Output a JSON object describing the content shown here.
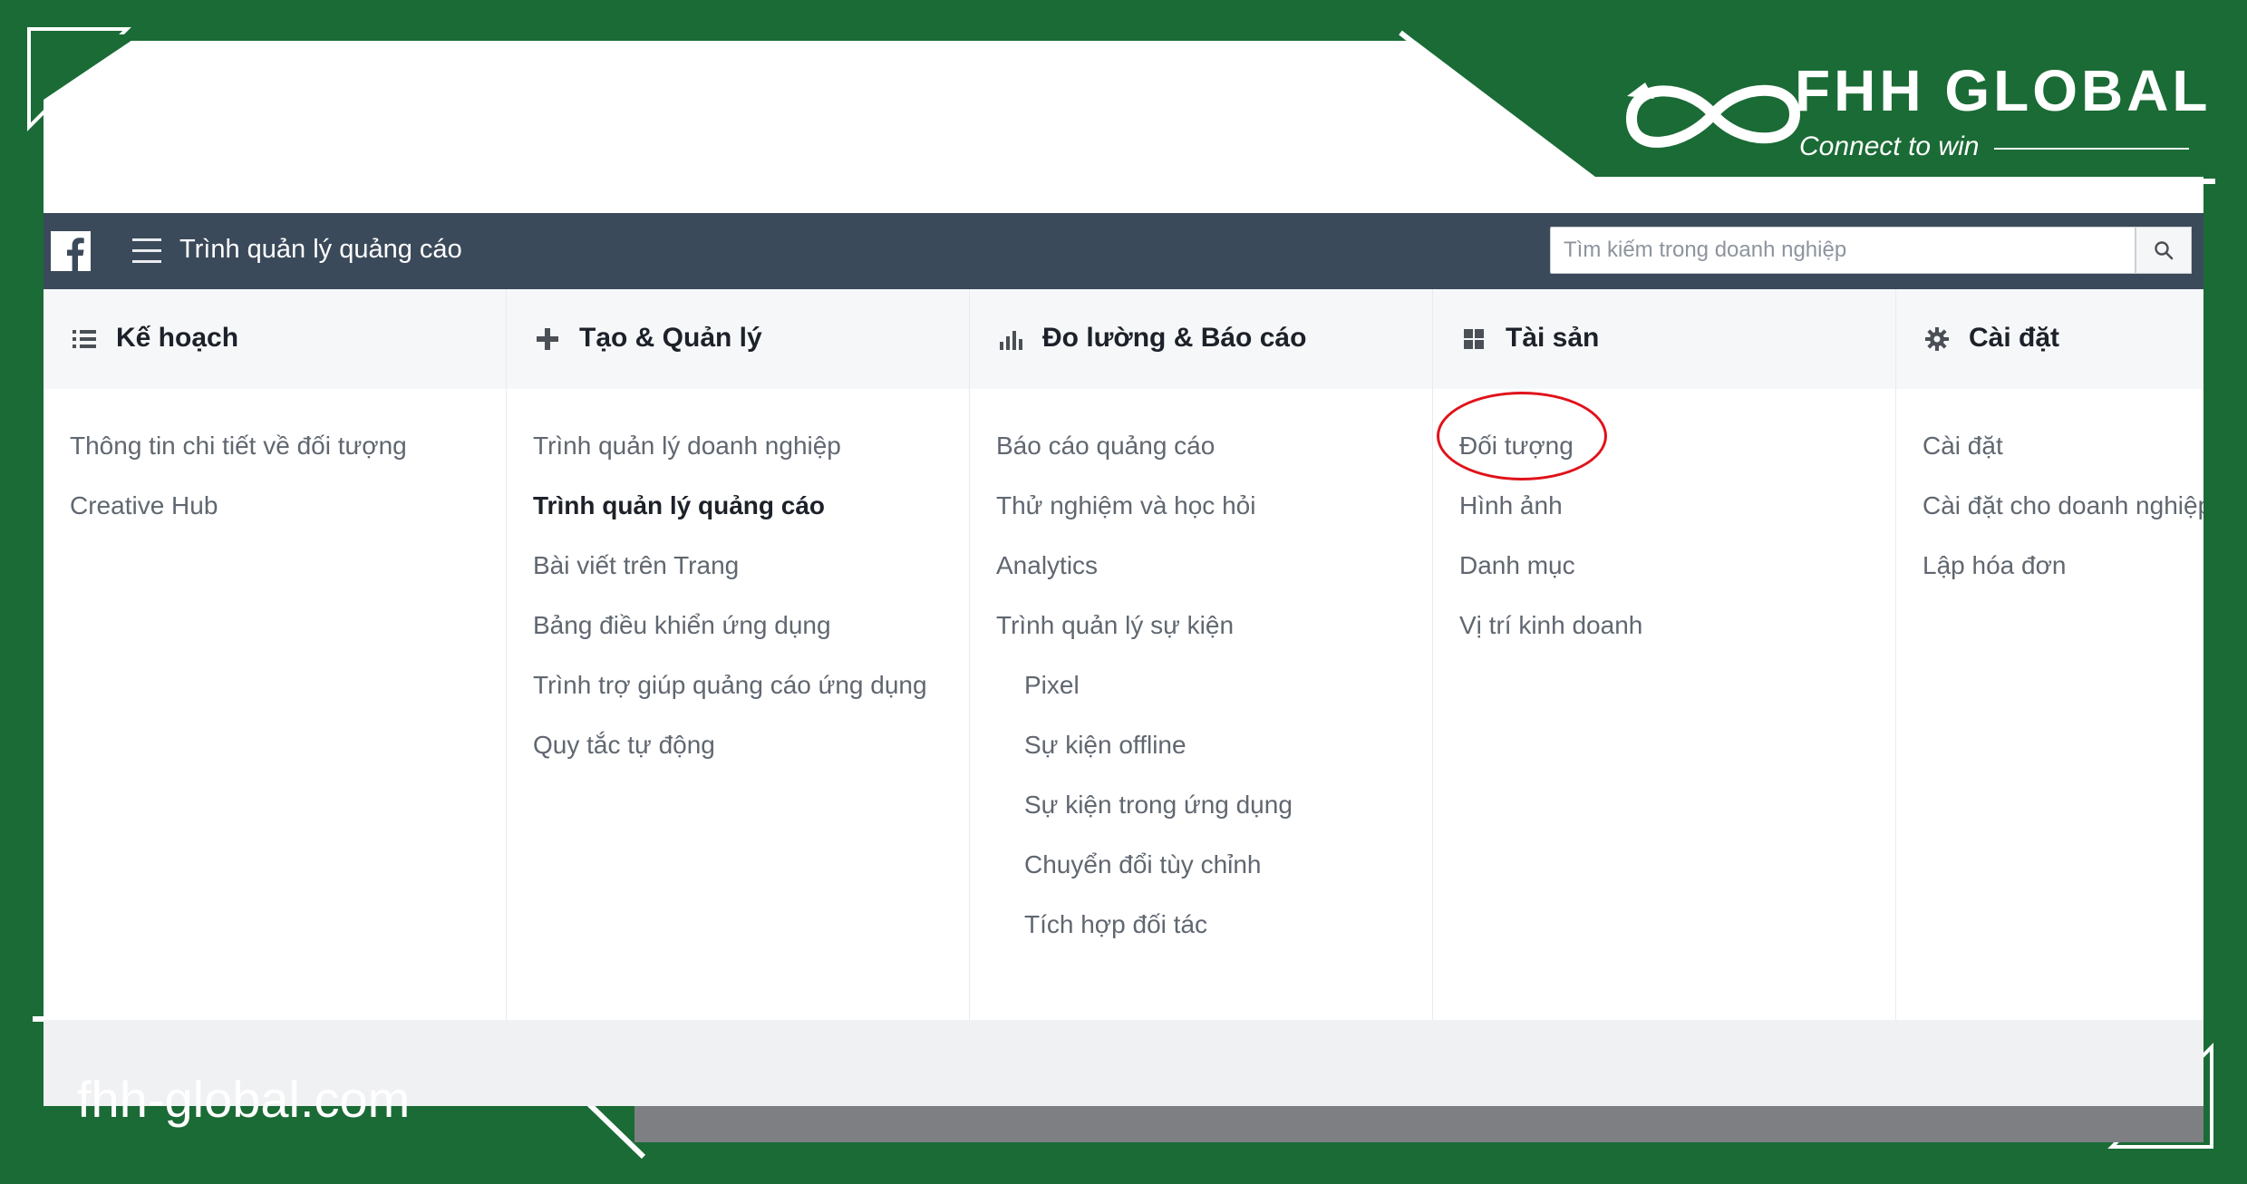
{
  "brand": {
    "name": "FHH GLOBAL",
    "tagline": "Connect to win",
    "url": "fhh-global.com",
    "colors": {
      "green": "#1a6b35",
      "white": "#ffffff",
      "annotation": "#e0121a"
    }
  },
  "header": {
    "title": "Trình quản lý quảng cáo",
    "menu_icon": "hamburger-icon",
    "logo_icon": "facebook-icon",
    "search": {
      "placeholder": "Tìm kiếm trong doanh nghiệp",
      "icon": "search-icon"
    },
    "bar_color": "#3b4a5a"
  },
  "columns": [
    {
      "heading": "Kế hoạch",
      "icon": "list-icon",
      "items": [
        {
          "label": "Thông tin chi tiết về đối tượng"
        },
        {
          "label": "Creative Hub"
        }
      ]
    },
    {
      "heading": "Tạo & Quản lý",
      "icon": "plus-icon",
      "items": [
        {
          "label": "Trình quản lý doanh nghiệp"
        },
        {
          "label": "Trình quản lý quảng cáo",
          "active": true
        },
        {
          "label": "Bài viết trên Trang"
        },
        {
          "label": "Bảng điều khiển ứng dụng"
        },
        {
          "label": "Trình trợ giúp quảng cáo ứng dụng"
        },
        {
          "label": "Quy tắc tự động"
        }
      ]
    },
    {
      "heading": "Đo lường & Báo cáo",
      "icon": "bar-chart-icon",
      "items": [
        {
          "label": "Báo cáo quảng cáo"
        },
        {
          "label": "Thử nghiệm và học hỏi"
        },
        {
          "label": "Analytics"
        },
        {
          "label": "Trình quản lý sự kiện"
        },
        {
          "label": "Pixel",
          "sub": true
        },
        {
          "label": "Sự kiện offline",
          "sub": true
        },
        {
          "label": "Sự kiện trong ứng dụng",
          "sub": true
        },
        {
          "label": "Chuyển đổi tùy chỉnh",
          "sub": true
        },
        {
          "label": "Tích hợp đối tác",
          "sub": true
        }
      ]
    },
    {
      "heading": "Tài sản",
      "icon": "grid-icon",
      "items": [
        {
          "label": "Đối tượng",
          "highlighted": true
        },
        {
          "label": "Hình ảnh"
        },
        {
          "label": "Danh mục"
        },
        {
          "label": "Vị trí kinh doanh"
        }
      ]
    },
    {
      "heading": "Cài đặt",
      "icon": "gear-icon",
      "items": [
        {
          "label": "Cài đặt"
        },
        {
          "label": "Cài đặt cho doanh nghiệp"
        },
        {
          "label": "Lập hóa đơn"
        }
      ]
    }
  ]
}
